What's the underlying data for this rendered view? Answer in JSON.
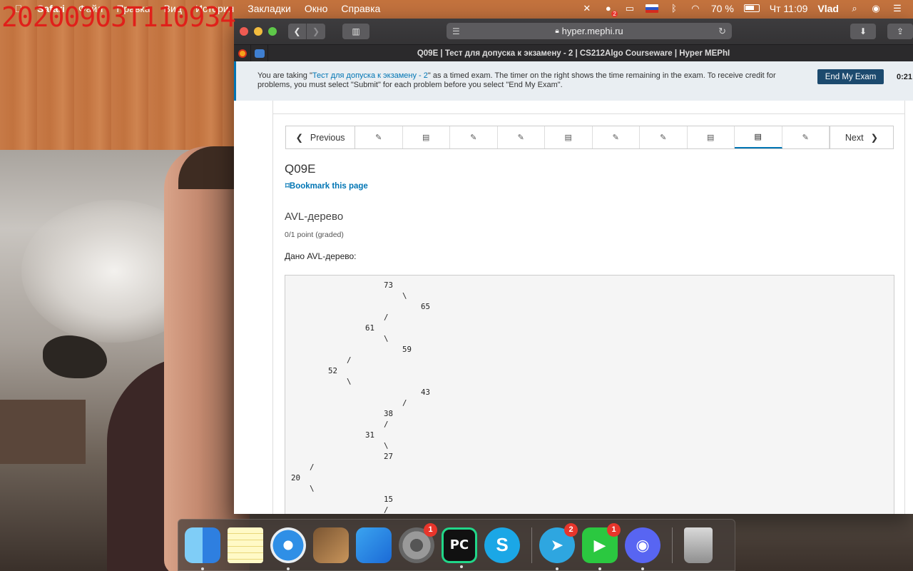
{
  "overlay": {
    "timestamp": "20200903T110934"
  },
  "menubar": {
    "app": "Safari",
    "items": [
      "Файл",
      "Правка",
      "Вид",
      "История",
      "Закладки",
      "Окно",
      "Справка"
    ],
    "battery": "70 %",
    "clock": "Чт 11:09",
    "user": "Vlad",
    "notification_badge": "2"
  },
  "browser": {
    "url": "hyper.mephi.ru",
    "tab_title": "Q09E | Тест для допуска к экзамену - 2 | CS212Algo Courseware | Hyper MEPhI"
  },
  "exam_banner": {
    "text_before": "You are taking \"",
    "exam_link": "Тест для допуска к экзамену - 2",
    "text_after": "\" as a timed exam. The timer on the right shows the time remaining in the exam. To receive credit for problems, you must select \"Submit\" for each problem before you select \"End My Exam\".",
    "end_button": "End My Exam",
    "timer": "0:21:"
  },
  "sequence_nav": {
    "previous": "Previous",
    "next": "Next",
    "units": [
      {
        "icon": "✎",
        "type": "problem"
      },
      {
        "icon": "▤",
        "type": "other"
      },
      {
        "icon": "✎",
        "type": "problem"
      },
      {
        "icon": "✎",
        "type": "problem"
      },
      {
        "icon": "▤",
        "type": "other"
      },
      {
        "icon": "✎",
        "type": "problem"
      },
      {
        "icon": "✎",
        "type": "problem"
      },
      {
        "icon": "▤",
        "type": "other"
      },
      {
        "icon": "▤",
        "type": "other",
        "active": true
      },
      {
        "icon": "✎",
        "type": "problem"
      }
    ]
  },
  "page": {
    "title": "Q09E",
    "bookmark": "Bookmark this page",
    "problem_title": "AVL-дерево",
    "points": "0/1 point (graded)",
    "prompt": "Дано AVL-дерево:",
    "tree_text": "                    73\n                        \\\n                            65\n                    /\n                61\n                    \\\n                        59\n            /\n        52\n            \\\n                            43\n                        /\n                    38\n                    /\n                31\n                    \\\n                    27\n    /\n20\n    \\\n                    15\n                    /"
  },
  "dock": {
    "apps": [
      {
        "name": "finder",
        "label": "",
        "badge": "",
        "running": true
      },
      {
        "name": "notes",
        "label": "",
        "badge": "",
        "running": false
      },
      {
        "name": "safari",
        "label": "",
        "badge": "",
        "running": true
      },
      {
        "name": "garageband",
        "label": "",
        "badge": "",
        "running": false
      },
      {
        "name": "xcode",
        "label": "",
        "badge": "",
        "running": false
      },
      {
        "name": "system-preferences",
        "label": "",
        "badge": "1",
        "running": false
      },
      {
        "name": "pycharm",
        "label": "PC",
        "badge": "",
        "running": true
      },
      {
        "name": "skype",
        "label": "S",
        "badge": "",
        "running": false
      },
      {
        "name": "telegram",
        "label": "",
        "badge": "2",
        "running": true
      },
      {
        "name": "facetime",
        "label": "",
        "badge": "1",
        "running": true
      },
      {
        "name": "discord",
        "label": "",
        "badge": "",
        "running": true
      },
      {
        "name": "trash",
        "label": "",
        "badge": "",
        "running": false
      }
    ]
  }
}
